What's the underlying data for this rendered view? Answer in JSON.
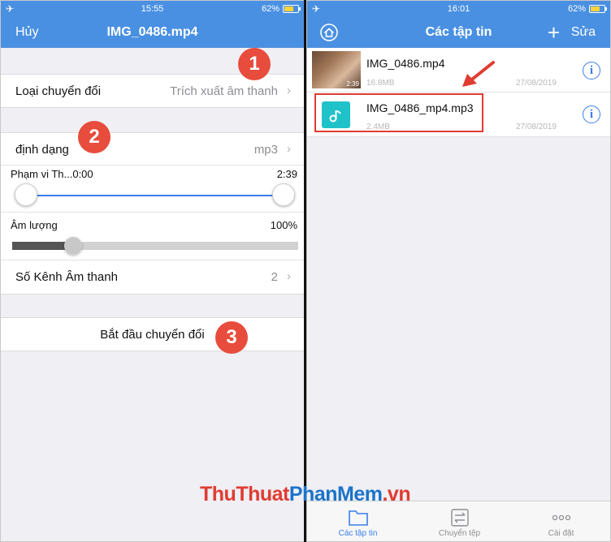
{
  "left": {
    "status": {
      "time": "15:55",
      "battery": "62%",
      "battery_level": 0.62
    },
    "nav": {
      "cancel": "Hủy",
      "title": "IMG_0486.mp4"
    },
    "conversion_type": {
      "label": "Loại chuyển đổi",
      "value": "Trích xuất âm thanh"
    },
    "format": {
      "label": "định dạng",
      "value": "mp3"
    },
    "range": {
      "label": "Phạm vi Th...0:00",
      "end": "2:39",
      "start_fraction": 0.0,
      "end_fraction": 1.0
    },
    "volume": {
      "label": "Âm lượng",
      "value": "100%",
      "slider_fraction": 0.22
    },
    "channels": {
      "label": "Số Kênh Âm thanh",
      "value": "2"
    },
    "start_button": "Bắt đầu chuyển đổi",
    "steps": [
      "1",
      "2",
      "3"
    ]
  },
  "right": {
    "status": {
      "time": "16:01",
      "battery": "62%",
      "battery_level": 0.62
    },
    "nav": {
      "title": "Các tập tin",
      "add": "+",
      "edit": "Sửa"
    },
    "files": [
      {
        "name": "IMG_0486.mp4",
        "size": "16.8MB",
        "date": "27/08/2019",
        "duration": "2:39",
        "type": "video"
      },
      {
        "name": "IMG_0486_mp4.mp3",
        "size": "2.4MB",
        "date": "27/08/2019",
        "type": "audio"
      }
    ],
    "tabs": [
      {
        "label": "Các tập tin",
        "icon": "folder-icon",
        "active": true
      },
      {
        "label": "Chuyển tệp",
        "icon": "transfer-icon",
        "active": false
      },
      {
        "label": "Cài đặt",
        "icon": "more-icon",
        "active": false
      }
    ]
  },
  "watermark": {
    "part1": "Thu",
    "part2": "Thuat",
    "part3": "PhanMem",
    "part4": ".vn"
  },
  "colors": {
    "accent": "#4a90e2",
    "badge": "#e74c3c",
    "audio_icon": "#1fc2c9",
    "highlight": "#e03c31"
  }
}
